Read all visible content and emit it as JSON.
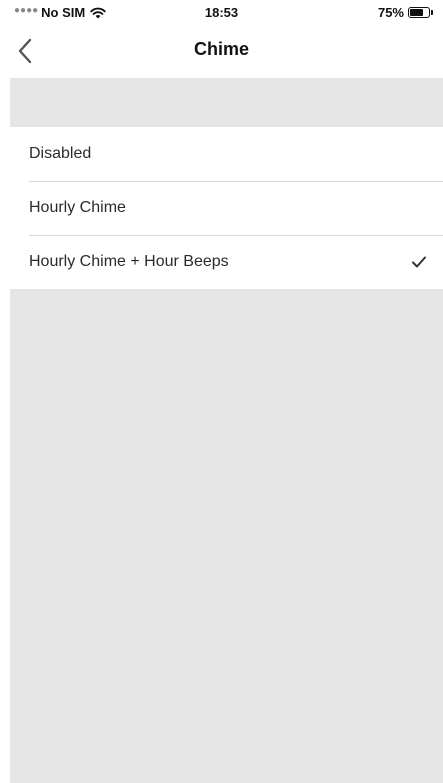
{
  "status_bar": {
    "carrier": "No SIM",
    "time": "18:53",
    "battery_percent": "75%",
    "battery_level": 0.75,
    "icons": [
      "signal-dots-icon",
      "wifi-icon",
      "battery-icon"
    ]
  },
  "nav": {
    "title": "Chime",
    "back_icon": "chevron-left-icon"
  },
  "options": [
    {
      "label": "Disabled",
      "selected": false
    },
    {
      "label": "Hourly Chime",
      "selected": false
    },
    {
      "label": "Hourly Chime + Hour Beeps",
      "selected": true
    }
  ],
  "colors": {
    "background_grouped": "#e5e5e5",
    "row_background": "#ffffff",
    "separator": "#d8d8d8",
    "text": "#2b2b2b"
  }
}
